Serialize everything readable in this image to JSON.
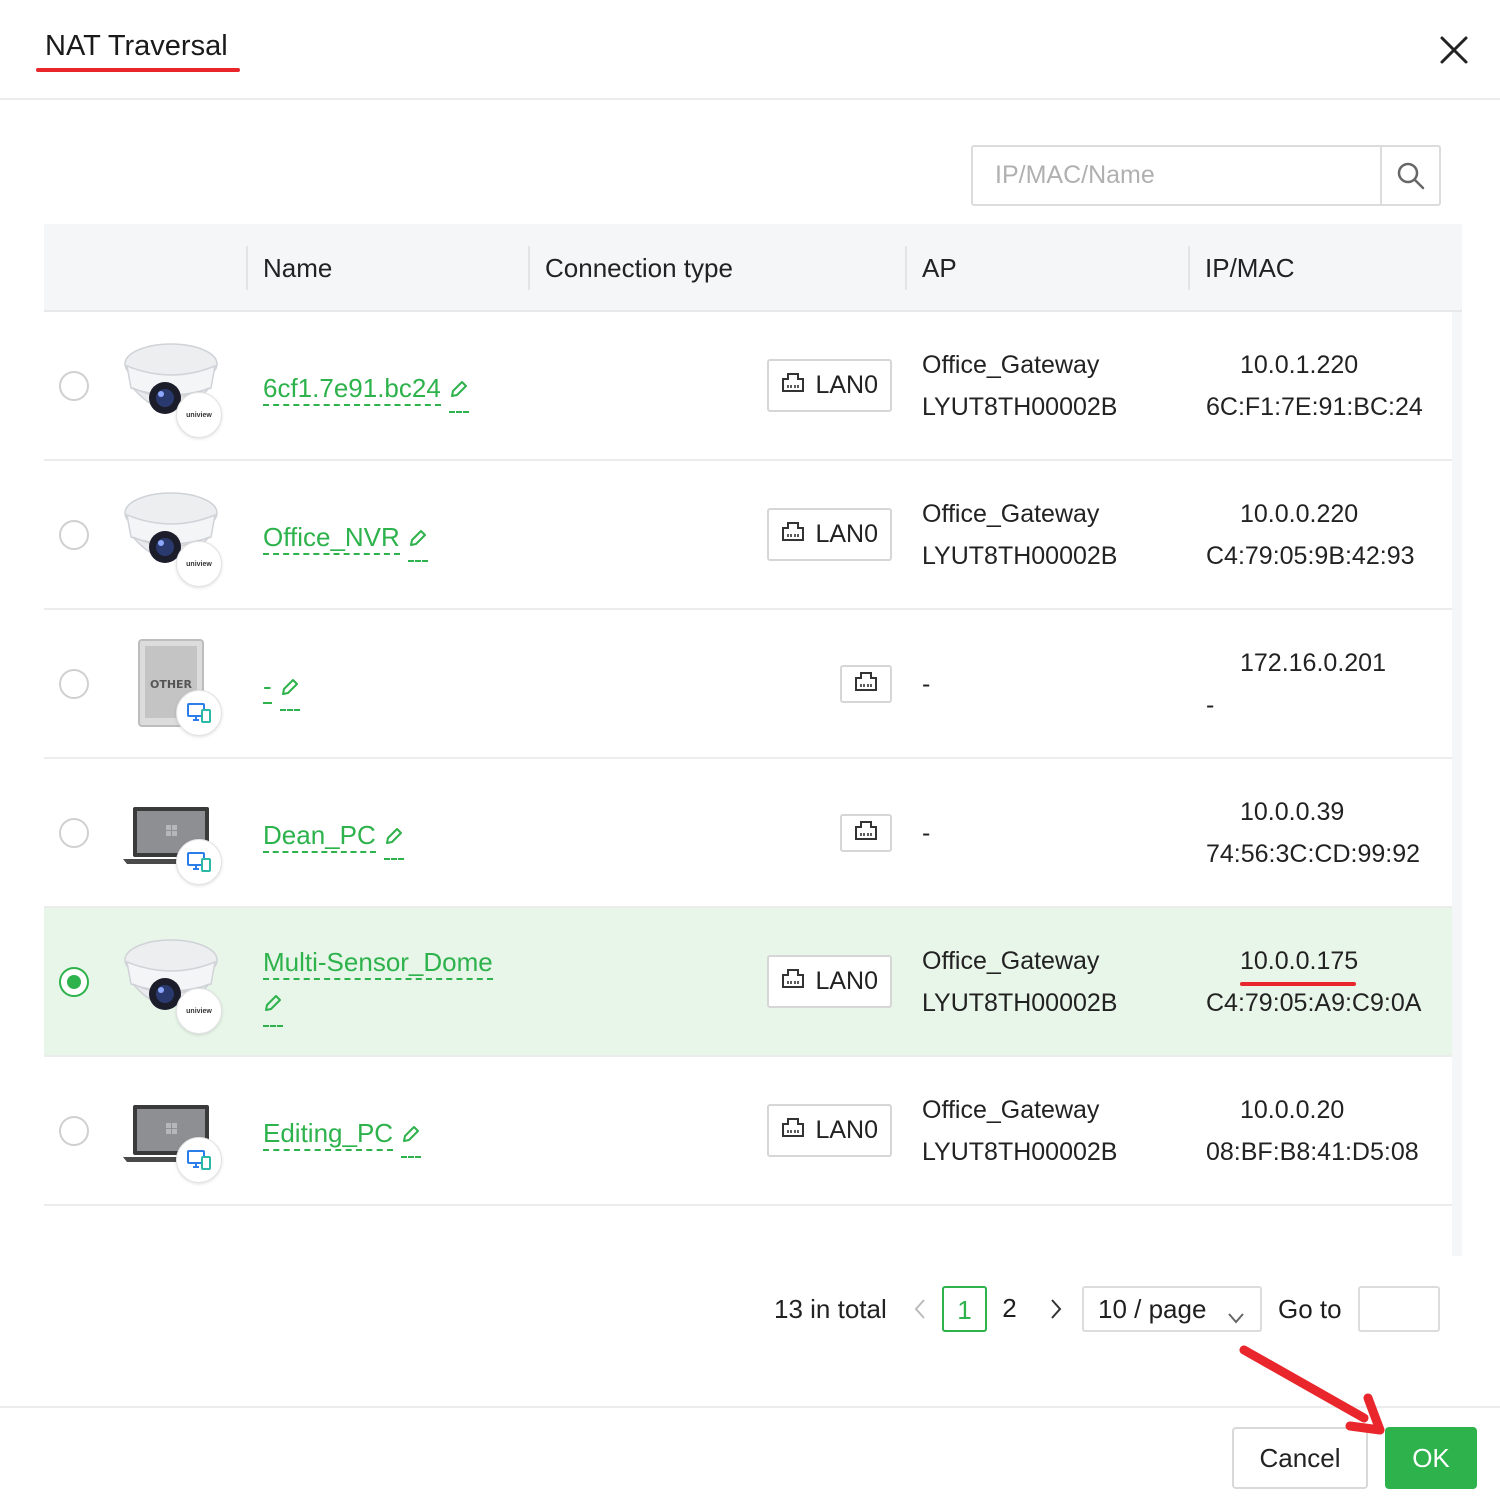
{
  "dialog": {
    "title": "NAT Traversal"
  },
  "search": {
    "placeholder": "IP/MAC/Name"
  },
  "table": {
    "columns": [
      "Name",
      "Connection type",
      "AP",
      "IP/MAC"
    ],
    "rows": [
      {
        "icon": "dome-camera-icon",
        "badge": "uniview",
        "name": "6cf1.7e91.bc24",
        "conn": "LAN0",
        "ap": "Office_Gateway",
        "ap_sn": "LYUT8TH00002B",
        "ip": "10.0.1.220",
        "mac": "6C:F1:7E:91:BC:24",
        "selected": false
      },
      {
        "icon": "dome-camera-icon",
        "badge": "uniview",
        "name": "Office_NVR",
        "conn": "LAN0",
        "ap": "Office_Gateway",
        "ap_sn": "LYUT8TH00002B",
        "ip": "10.0.0.220",
        "mac": "C4:79:05:9B:42:93",
        "selected": false
      },
      {
        "icon": "other-device-icon",
        "icon_label": "OTHER",
        "badge": "multi-device-icon",
        "name": "-",
        "conn": "",
        "ap": "-",
        "ap_sn": "",
        "ip": "172.16.0.201",
        "mac": "-",
        "selected": false
      },
      {
        "icon": "laptop-icon",
        "badge": "multi-device-icon",
        "name": "Dean_PC",
        "conn": "",
        "ap": "-",
        "ap_sn": "",
        "ip": "10.0.0.39",
        "mac": "74:56:3C:CD:99:92",
        "selected": false
      },
      {
        "icon": "dome-camera-icon",
        "badge": "uniview",
        "name": "Multi-Sensor_Dome",
        "conn": "LAN0",
        "ap": "Office_Gateway",
        "ap_sn": "LYUT8TH00002B",
        "ip": "10.0.0.175",
        "mac": "C4:79:05:A9:C9:0A",
        "selected": true
      },
      {
        "icon": "laptop-icon",
        "badge": "multi-device-icon",
        "name": "Editing_PC",
        "conn": "LAN0",
        "ap": "Office_Gateway",
        "ap_sn": "LYUT8TH00002B",
        "ip": "10.0.0.20",
        "mac": "08:BF:B8:41:D5:08",
        "selected": false
      }
    ]
  },
  "pagination": {
    "total": "13 in total",
    "pages": [
      "1",
      "2"
    ],
    "current_page": "1",
    "page_size": "10 / page",
    "goto_label": "Go to"
  },
  "footer": {
    "cancel_label": "Cancel",
    "ok_label": "OK"
  },
  "colors": {
    "accent": "#2db24c",
    "selected_row": "#e8f5e9",
    "annotation_red": "#e8262c"
  }
}
